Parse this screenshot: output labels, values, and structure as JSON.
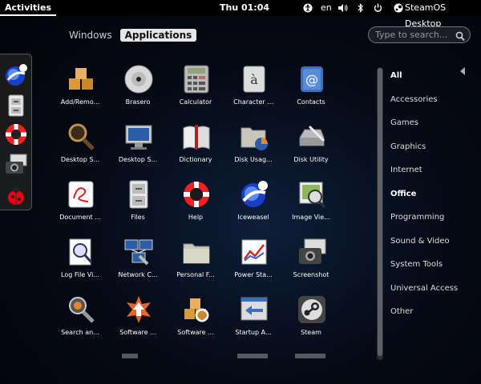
{
  "topbar": {
    "activities": "Activities",
    "clock": "Thu 01:04",
    "language": "en",
    "session": "SteamOS Desktop"
  },
  "view_switch": {
    "windows": "Windows",
    "applications": "Applications"
  },
  "search": {
    "placeholder": "Type to search..."
  },
  "apps": [
    {
      "label": "Add/Remo...",
      "icon": "add-remove-icon"
    },
    {
      "label": "Brasero",
      "icon": "brasero-disc-icon"
    },
    {
      "label": "Calculator",
      "icon": "calculator-icon"
    },
    {
      "label": "Character ...",
      "icon": "character-map-icon"
    },
    {
      "label": "Contacts",
      "icon": "contacts-icon"
    },
    {
      "label": "Desktop S...",
      "icon": "desktop-search-icon"
    },
    {
      "label": "Desktop S...",
      "icon": "desktop-settings-icon"
    },
    {
      "label": "Dictionary",
      "icon": "dictionary-icon"
    },
    {
      "label": "Disk Usag...",
      "icon": "disk-usage-icon"
    },
    {
      "label": "Disk Utility",
      "icon": "disk-utility-icon"
    },
    {
      "label": "Document ...",
      "icon": "document-viewer-icon"
    },
    {
      "label": "Files",
      "icon": "files-icon"
    },
    {
      "label": "Help",
      "icon": "help-icon"
    },
    {
      "label": "Iceweasel",
      "icon": "iceweasel-icon"
    },
    {
      "label": "Image Vie...",
      "icon": "image-viewer-icon"
    },
    {
      "label": "Log File Vi...",
      "icon": "log-file-viewer-icon"
    },
    {
      "label": "Network C...",
      "icon": "network-connections-icon"
    },
    {
      "label": "Personal F...",
      "icon": "personal-file-sharing-icon"
    },
    {
      "label": "Power Sta...",
      "icon": "power-statistics-icon"
    },
    {
      "label": "Screenshot",
      "icon": "screenshot-icon"
    },
    {
      "label": "Search an...",
      "icon": "search-and-index-icon"
    },
    {
      "label": "Software ...",
      "icon": "software-update-icon"
    },
    {
      "label": "Software ...",
      "icon": "software-center-icon"
    },
    {
      "label": "Startup A...",
      "icon": "startup-applications-icon"
    },
    {
      "label": "Steam",
      "icon": "steam-icon"
    }
  ],
  "categories": [
    "All",
    "Accessories",
    "Games",
    "Graphics",
    "Internet",
    "Office",
    "Programming",
    "Sound & Video",
    "System Tools",
    "Universal Access",
    "Other"
  ],
  "selected_categories": [
    "All",
    "Office"
  ]
}
